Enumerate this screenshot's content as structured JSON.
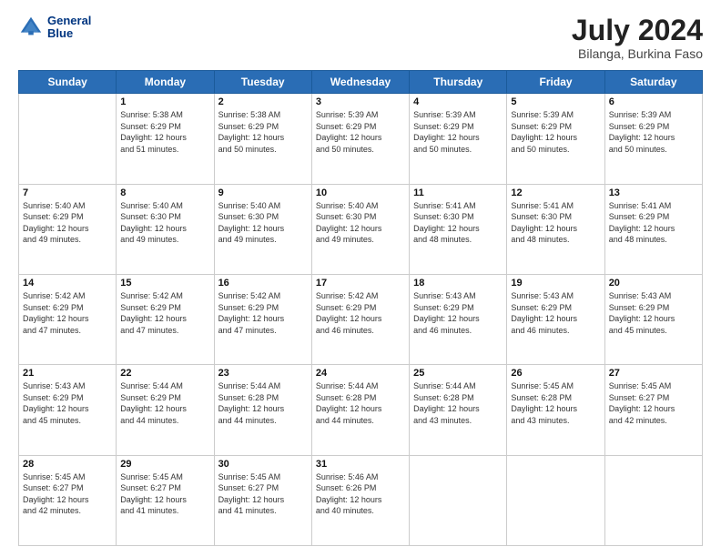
{
  "header": {
    "logo_line1": "General",
    "logo_line2": "Blue",
    "title": "July 2024",
    "subtitle": "Bilanga, Burkina Faso"
  },
  "weekdays": [
    "Sunday",
    "Monday",
    "Tuesday",
    "Wednesday",
    "Thursday",
    "Friday",
    "Saturday"
  ],
  "weeks": [
    [
      {
        "day": "",
        "info": ""
      },
      {
        "day": "1",
        "info": "Sunrise: 5:38 AM\nSunset: 6:29 PM\nDaylight: 12 hours\nand 51 minutes."
      },
      {
        "day": "2",
        "info": "Sunrise: 5:38 AM\nSunset: 6:29 PM\nDaylight: 12 hours\nand 50 minutes."
      },
      {
        "day": "3",
        "info": "Sunrise: 5:39 AM\nSunset: 6:29 PM\nDaylight: 12 hours\nand 50 minutes."
      },
      {
        "day": "4",
        "info": "Sunrise: 5:39 AM\nSunset: 6:29 PM\nDaylight: 12 hours\nand 50 minutes."
      },
      {
        "day": "5",
        "info": "Sunrise: 5:39 AM\nSunset: 6:29 PM\nDaylight: 12 hours\nand 50 minutes."
      },
      {
        "day": "6",
        "info": "Sunrise: 5:39 AM\nSunset: 6:29 PM\nDaylight: 12 hours\nand 50 minutes."
      }
    ],
    [
      {
        "day": "7",
        "info": "Sunrise: 5:40 AM\nSunset: 6:29 PM\nDaylight: 12 hours\nand 49 minutes."
      },
      {
        "day": "8",
        "info": "Sunrise: 5:40 AM\nSunset: 6:30 PM\nDaylight: 12 hours\nand 49 minutes."
      },
      {
        "day": "9",
        "info": "Sunrise: 5:40 AM\nSunset: 6:30 PM\nDaylight: 12 hours\nand 49 minutes."
      },
      {
        "day": "10",
        "info": "Sunrise: 5:40 AM\nSunset: 6:30 PM\nDaylight: 12 hours\nand 49 minutes."
      },
      {
        "day": "11",
        "info": "Sunrise: 5:41 AM\nSunset: 6:30 PM\nDaylight: 12 hours\nand 48 minutes."
      },
      {
        "day": "12",
        "info": "Sunrise: 5:41 AM\nSunset: 6:30 PM\nDaylight: 12 hours\nand 48 minutes."
      },
      {
        "day": "13",
        "info": "Sunrise: 5:41 AM\nSunset: 6:29 PM\nDaylight: 12 hours\nand 48 minutes."
      }
    ],
    [
      {
        "day": "14",
        "info": "Sunrise: 5:42 AM\nSunset: 6:29 PM\nDaylight: 12 hours\nand 47 minutes."
      },
      {
        "day": "15",
        "info": "Sunrise: 5:42 AM\nSunset: 6:29 PM\nDaylight: 12 hours\nand 47 minutes."
      },
      {
        "day": "16",
        "info": "Sunrise: 5:42 AM\nSunset: 6:29 PM\nDaylight: 12 hours\nand 47 minutes."
      },
      {
        "day": "17",
        "info": "Sunrise: 5:42 AM\nSunset: 6:29 PM\nDaylight: 12 hours\nand 46 minutes."
      },
      {
        "day": "18",
        "info": "Sunrise: 5:43 AM\nSunset: 6:29 PM\nDaylight: 12 hours\nand 46 minutes."
      },
      {
        "day": "19",
        "info": "Sunrise: 5:43 AM\nSunset: 6:29 PM\nDaylight: 12 hours\nand 46 minutes."
      },
      {
        "day": "20",
        "info": "Sunrise: 5:43 AM\nSunset: 6:29 PM\nDaylight: 12 hours\nand 45 minutes."
      }
    ],
    [
      {
        "day": "21",
        "info": "Sunrise: 5:43 AM\nSunset: 6:29 PM\nDaylight: 12 hours\nand 45 minutes."
      },
      {
        "day": "22",
        "info": "Sunrise: 5:44 AM\nSunset: 6:29 PM\nDaylight: 12 hours\nand 44 minutes."
      },
      {
        "day": "23",
        "info": "Sunrise: 5:44 AM\nSunset: 6:28 PM\nDaylight: 12 hours\nand 44 minutes."
      },
      {
        "day": "24",
        "info": "Sunrise: 5:44 AM\nSunset: 6:28 PM\nDaylight: 12 hours\nand 44 minutes."
      },
      {
        "day": "25",
        "info": "Sunrise: 5:44 AM\nSunset: 6:28 PM\nDaylight: 12 hours\nand 43 minutes."
      },
      {
        "day": "26",
        "info": "Sunrise: 5:45 AM\nSunset: 6:28 PM\nDaylight: 12 hours\nand 43 minutes."
      },
      {
        "day": "27",
        "info": "Sunrise: 5:45 AM\nSunset: 6:27 PM\nDaylight: 12 hours\nand 42 minutes."
      }
    ],
    [
      {
        "day": "28",
        "info": "Sunrise: 5:45 AM\nSunset: 6:27 PM\nDaylight: 12 hours\nand 42 minutes."
      },
      {
        "day": "29",
        "info": "Sunrise: 5:45 AM\nSunset: 6:27 PM\nDaylight: 12 hours\nand 41 minutes."
      },
      {
        "day": "30",
        "info": "Sunrise: 5:45 AM\nSunset: 6:27 PM\nDaylight: 12 hours\nand 41 minutes."
      },
      {
        "day": "31",
        "info": "Sunrise: 5:46 AM\nSunset: 6:26 PM\nDaylight: 12 hours\nand 40 minutes."
      },
      {
        "day": "",
        "info": ""
      },
      {
        "day": "",
        "info": ""
      },
      {
        "day": "",
        "info": ""
      }
    ]
  ]
}
